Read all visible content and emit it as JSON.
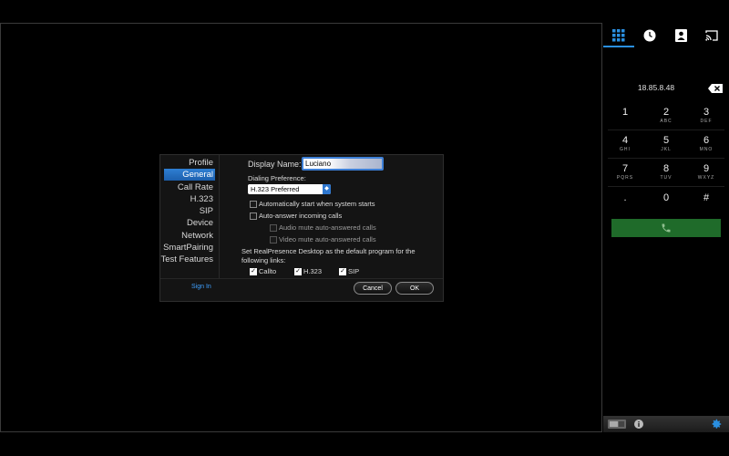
{
  "dialog": {
    "nav": [
      "Profile",
      "General",
      "Call Rate",
      "H.323",
      "SIP",
      "Device",
      "Network",
      "SmartPairing",
      "Test Features"
    ],
    "active_nav_index": 1,
    "sign_in": "Sign In",
    "display_name_label": "Display Name:",
    "display_name_value": "Luciano",
    "dialing_pref_label": "Dialing Preference:",
    "dialing_pref_value": "H.323 Preferred",
    "auto_start": "Automatically start when system starts",
    "auto_answer": "Auto-answer incoming calls",
    "audio_mute": "Audio mute auto-answered calls",
    "video_mute": "Video mute auto-answered calls",
    "default_program_line1": "Set RealPresence Desktop as the default program for the",
    "default_program_line2": "following links:",
    "links": [
      "Callto",
      "H.323",
      "SIP"
    ],
    "cancel": "Cancel",
    "ok": "OK"
  },
  "dialpad": {
    "ip": "18.85.8.48",
    "keys": [
      {
        "d": "1",
        "s": ""
      },
      {
        "d": "2",
        "s": "ABC"
      },
      {
        "d": "3",
        "s": "DEF"
      },
      {
        "d": "4",
        "s": "GHI"
      },
      {
        "d": "5",
        "s": "JKL"
      },
      {
        "d": "6",
        "s": "MNO"
      },
      {
        "d": "7",
        "s": "PQRS"
      },
      {
        "d": "8",
        "s": "TUV"
      },
      {
        "d": "9",
        "s": "WXYZ"
      },
      {
        "d": ".",
        "s": ""
      },
      {
        "d": "0",
        "s": ""
      },
      {
        "d": "#",
        "s": ""
      }
    ],
    "tab_icons": [
      "dialpad-icon",
      "clock-icon",
      "contacts-icon",
      "cast-icon"
    ],
    "accent": "#2a8fe0",
    "call_color": "#1f6b2a"
  }
}
